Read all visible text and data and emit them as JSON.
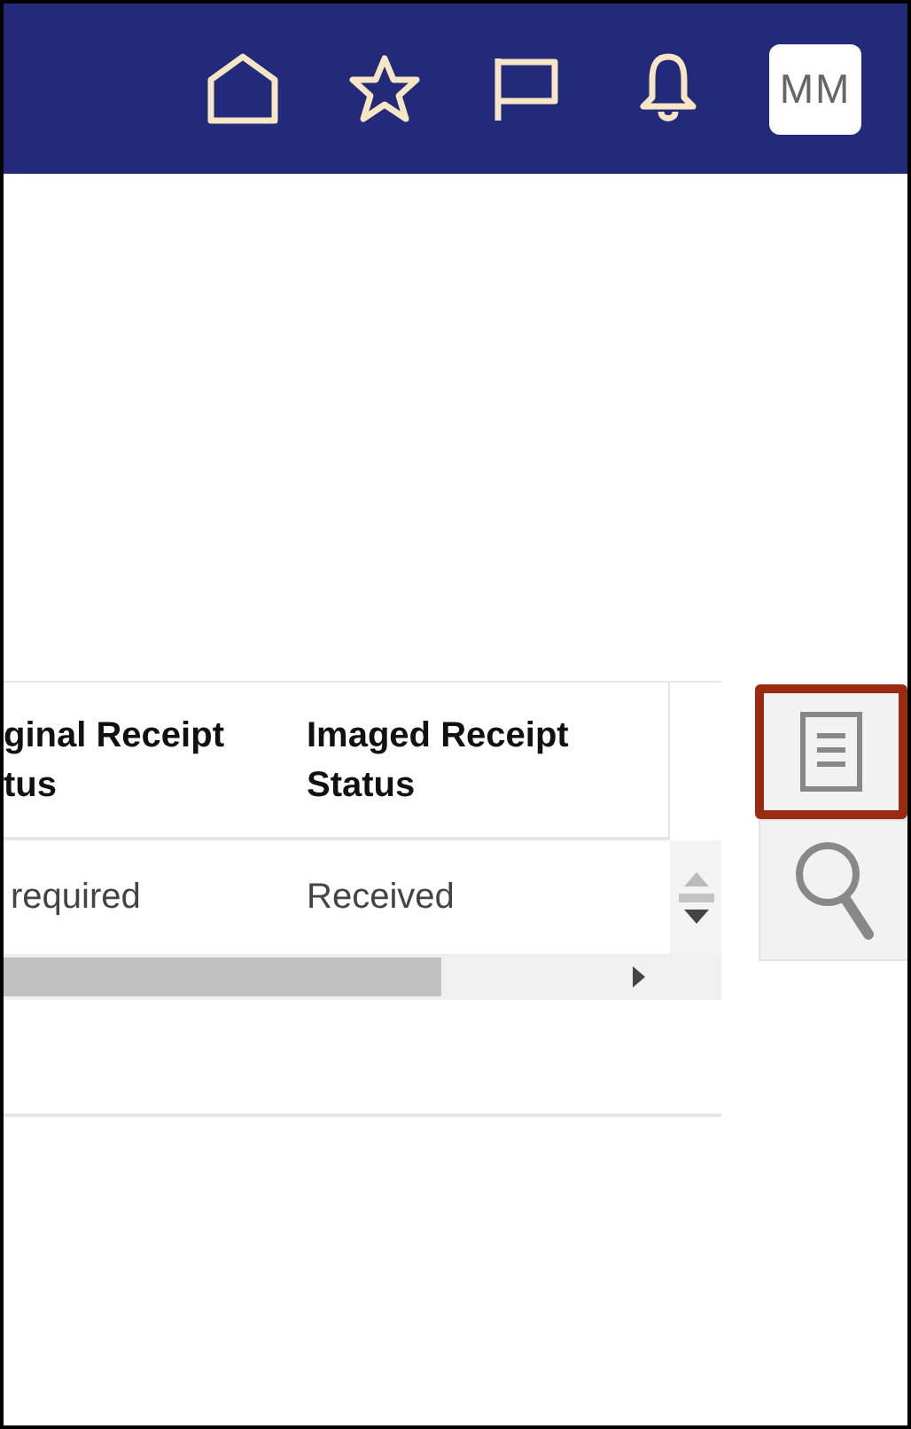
{
  "header": {
    "icons": [
      {
        "kind": "home"
      },
      {
        "kind": "star"
      },
      {
        "kind": "flag"
      },
      {
        "kind": "bell"
      }
    ],
    "avatar": "MM"
  },
  "table": {
    "columns": [
      {
        "lines": [
          "ginal Receipt",
          "tus"
        ]
      },
      {
        "lines": [
          "Imaged Receipt",
          "Status"
        ]
      }
    ],
    "rows": [
      [
        "required",
        "Received"
      ]
    ]
  },
  "side_tools": [
    {
      "kind": "document",
      "highlighted": true
    },
    {
      "kind": "search",
      "highlighted": false
    }
  ]
}
